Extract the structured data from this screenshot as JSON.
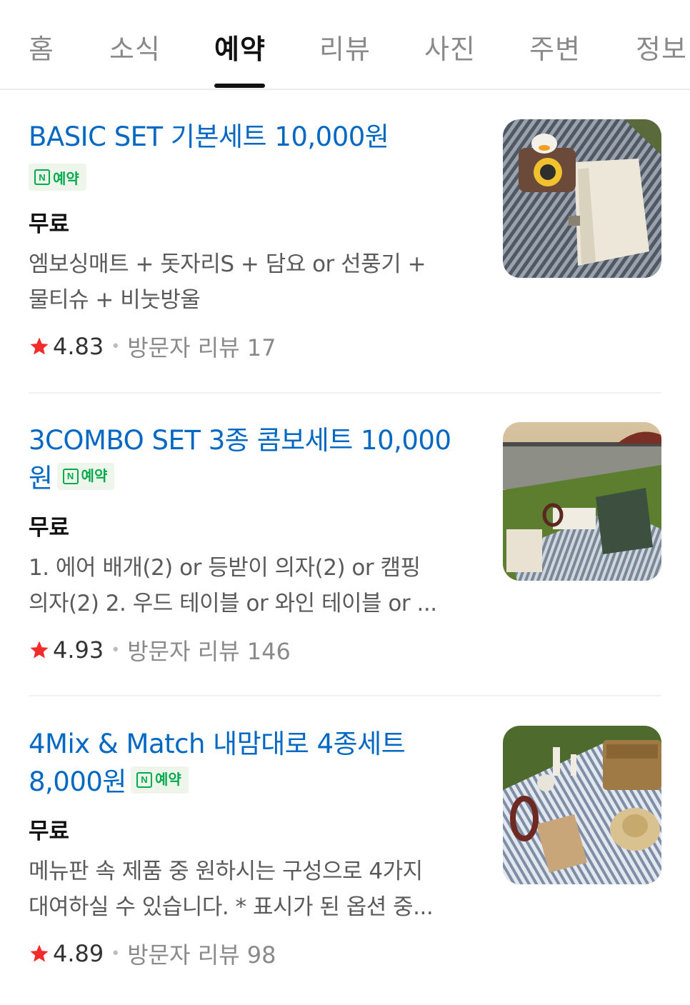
{
  "tabs": [
    {
      "label": "홈",
      "active": false
    },
    {
      "label": "소식",
      "active": false
    },
    {
      "label": "예약",
      "active": true
    },
    {
      "label": "리뷰",
      "active": false
    },
    {
      "label": "사진",
      "active": false
    },
    {
      "label": "주변",
      "active": false
    },
    {
      "label": "정보",
      "active": false
    }
  ],
  "badge_label": "예약",
  "badge_icon": "N",
  "items": [
    {
      "title": "BASIC SET 기본세트 10,000원",
      "price": "무료",
      "desc_lines": [
        "엠보싱매트 + 돗자리S + 담요 or 선풍기 +",
        "물티슈 + 비눗방울"
      ],
      "rating": "4.83",
      "reviews": "방문자 리뷰 17",
      "thumb_icon": "picnic-duck-camera-photo"
    },
    {
      "title": "3COMBO SET 3종 콤보세트 10,000원",
      "price": "무료",
      "desc_lines": [
        "1. 에어 배개(2) or 등받이 의자(2) or 캠핑",
        "의자(2) 2. 우드 테이블 or 와인 테이블 or ..."
      ],
      "rating": "4.93",
      "reviews": "방문자 리뷰 146",
      "thumb_icon": "riverside-picnic-photo"
    },
    {
      "title": "4Mix & Match 내맘대로 4종세트 8,000원",
      "price": "무료",
      "desc_lines": [
        "메뉴판 속 제품 중 원하시는 구성으로 4가지",
        "대여하실 수 있습니다. * 표시가 된 옵션 중..."
      ],
      "rating": "4.89",
      "reviews": "방문자 리뷰 98",
      "thumb_icon": "basket-picnic-photo"
    }
  ],
  "colors": {
    "title": "#0068c3",
    "badge_green": "#03a94d",
    "star": "#f22b2b"
  }
}
